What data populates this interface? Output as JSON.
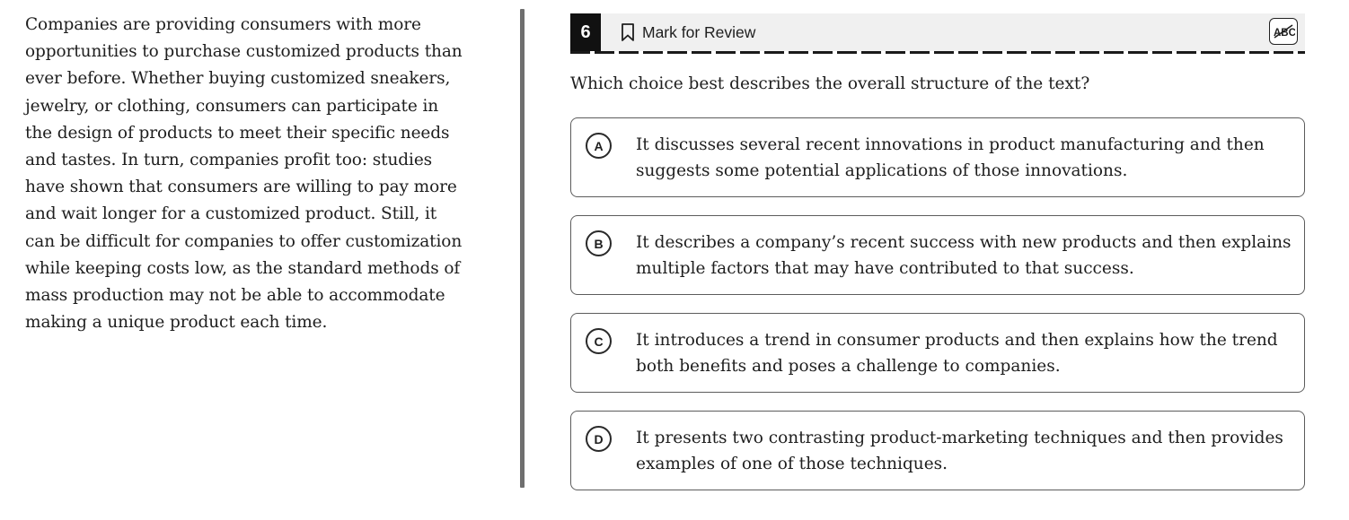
{
  "passage": {
    "text": "Companies are providing consumers with more opportunities to purchase customized products than ever before. Whether buying customized sneakers, jewelry, or clothing, consumers can participate in the design of products to meet their specific needs and tastes. In turn, companies profit too: studies have shown that consumers are willing to pay more and wait longer for a customized product. Still, it can be difficult for companies to offer customization while keeping costs low, as the standard methods of mass production may not be able to accommodate making a unique product each time."
  },
  "header": {
    "question_number": "6",
    "mark_for_review_label": "Mark for Review",
    "bookmark_icon": "bookmark-outline",
    "abc_icon": "abc-strikethrough"
  },
  "question": {
    "stem": "Which choice best describes the overall structure of the text?"
  },
  "choices": [
    {
      "letter": "A",
      "text": "It discusses several recent innovations in product manufacturing and then suggests some potential applications of those innovations."
    },
    {
      "letter": "B",
      "text": "It describes a company’s recent success with new products and then explains multiple factors that may have contributed to that success."
    },
    {
      "letter": "C",
      "text": "It introduces a trend in consumer products and then explains how the trend both benefits and poses a challenge to companies."
    },
    {
      "letter": "D",
      "text": "It presents two contrasting product-marketing techniques and then provides examples of one of those techniques."
    }
  ]
}
